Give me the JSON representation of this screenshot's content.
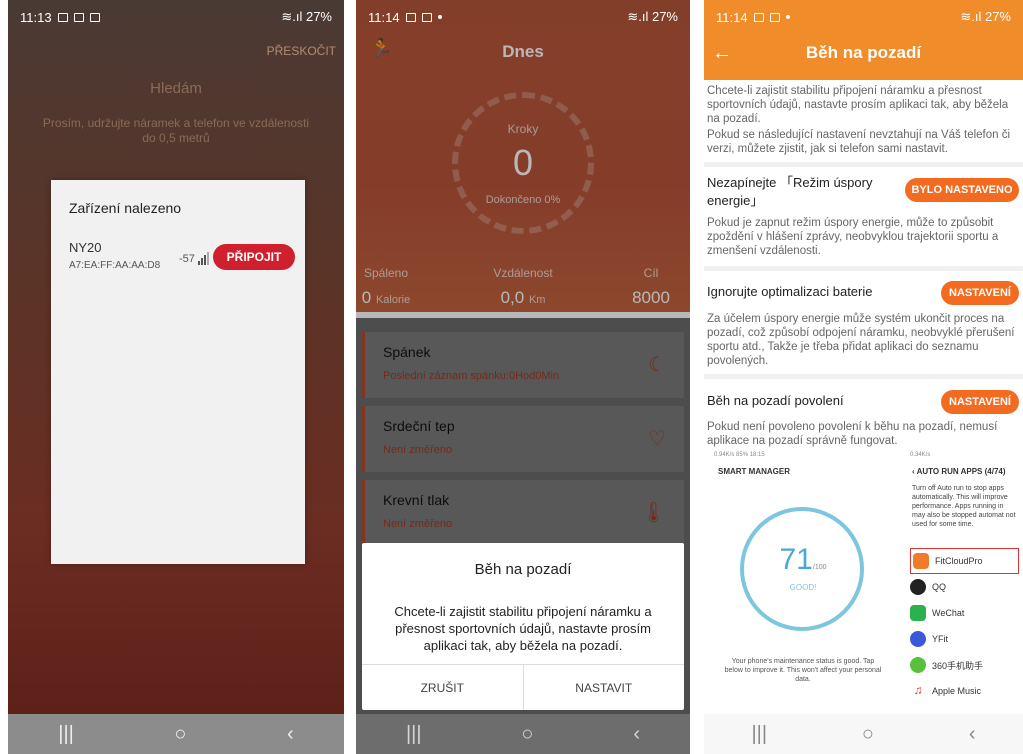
{
  "phone1": {
    "status": {
      "time": "11:13",
      "battery": "27%"
    },
    "skip": "PŘESKOČIT",
    "searching": "Hledám",
    "hint": "Prosím, udržujte náramek a telefon ve vzdálenosti do 0,5 metrů",
    "dialog": {
      "title": "Zařízení nalezeno",
      "device_name": "NY20",
      "device_mac": "A7:EA:FF:AA:AA:D8",
      "rssi": "-57",
      "connect": "PŘIPOJIT"
    }
  },
  "phone2": {
    "status": {
      "time": "11:14",
      "battery": "27%"
    },
    "title": "Dnes",
    "steps_label": "Kroky",
    "steps_value": "0",
    "completed": "Dokončeno 0%",
    "stats": [
      {
        "label": "Spáleno",
        "value": "0",
        "unit": "Kalorie"
      },
      {
        "label": "Vzdálenost",
        "value": "0,0",
        "unit": "Km"
      },
      {
        "label": "Cíl",
        "value": "8000",
        "unit": ""
      }
    ],
    "cards": [
      {
        "title": "Spánek",
        "sub": "Poslední záznam spánku:0Hod0Min",
        "icon": "sleep-icon"
      },
      {
        "title": "Srdeční tep",
        "sub": "Není změřeno",
        "icon": "heart-icon"
      },
      {
        "title": "Krevní tlak",
        "sub": "Není změřeno",
        "icon": "thermometer-icon"
      }
    ],
    "dialog": {
      "title": "Běh na pozadí",
      "body": "Chcete-li zajistit stabilitu připojení náramku a přesnost sportovních údajů, nastavte prosím aplikaci tak, aby běžela na pozadí.",
      "cancel": "ZRUŠIT",
      "ok": "NASTAVIT"
    }
  },
  "phone3": {
    "status": {
      "time": "11:14",
      "battery": "27%"
    },
    "title": "Běh na pozadí",
    "intro1": "Chcete-li zajistit stabilitu připojení náramku a přesnost sportovních údajů, nastavte prosím aplikaci tak, aby běžela na pozadí.",
    "intro2": "Pokud se následující nastavení nevztahují na Váš telefon či verzi, můžete zjistit, jak si telefon sami nastavit.",
    "sections": [
      {
        "heading": "Nezapínejte 「Režim úspory energie」",
        "button": "BYLO NASTAVENO",
        "text": "Pokud je zapnut režim úspory energie, může to způsobit zpoždění v hlášení zprávy, neobvyklou trajektorii sportu a zmenšení vzdálenosti."
      },
      {
        "heading": "Ignorujte optimalizaci baterie",
        "button": "NASTAVENÍ",
        "text": "Za účelem úspory energie může systém ukončit proces na pozadí, což způsobí odpojení náramku, neobvyklé přerušení sportu atd., Takže je třeba přidat aplikaci do seznamu povolených."
      },
      {
        "heading": "Běh na pozadí povolení",
        "button": "NASTAVENÍ",
        "text": "Pokud není povoleno povolení k běhu na pozadí, nemusí aplikace na pozadí správně fungovat."
      }
    ],
    "shot1": {
      "status": "0.94K/s 85% 18:15",
      "title": "SMART MANAGER",
      "score": "71",
      "score_max": "/100",
      "score_label": "GOOD!",
      "footer": "Your phone's maintenance status is good. Tap below to improve it. This won't affect your personal data."
    },
    "shot2": {
      "status": "0.34K/s",
      "title": "AUTO RUN APPS (4/74)",
      "desc": "Turn off Auto run to stop apps automatically. This will improve performance. Apps running in may also be stopped automat not used for some time.",
      "apps": [
        "FitCloudPro",
        "QQ",
        "WeChat",
        "YFit",
        "360手机助手",
        "Apple Music"
      ]
    }
  },
  "colors": {
    "accent": "#f26b20",
    "red": "#d0202d",
    "header_orange": "#f08c2a"
  }
}
